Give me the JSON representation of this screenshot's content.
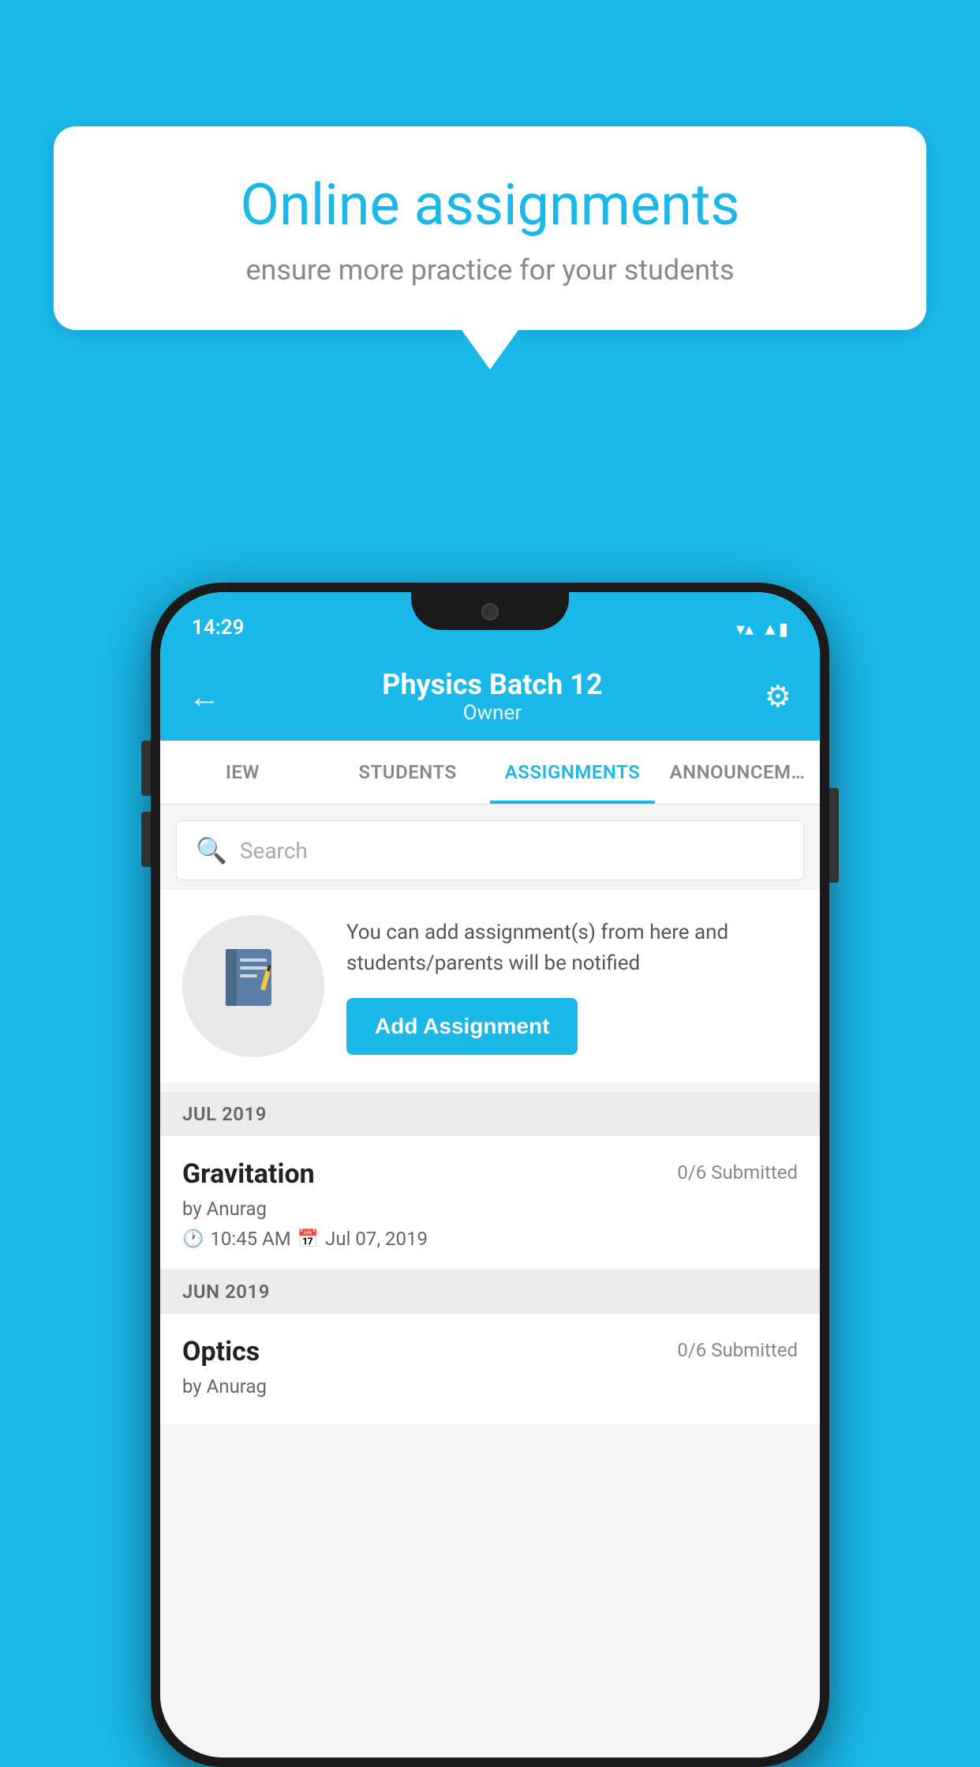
{
  "background_color": "#1ab8e8",
  "speech_bubble": {
    "title": "Online assignments",
    "subtitle": "ensure more practice for your students"
  },
  "status_bar": {
    "time": "14:29",
    "wifi_icon": "▼",
    "signal_icon": "▲",
    "battery_icon": "▮"
  },
  "app_bar": {
    "back_arrow": "←",
    "title": "Physics Batch 12",
    "subtitle": "Owner",
    "settings_icon": "⚙"
  },
  "tabs": [
    {
      "label": "IEW",
      "active": false
    },
    {
      "label": "STUDENTS",
      "active": false
    },
    {
      "label": "ASSIGNMENTS",
      "active": true
    },
    {
      "label": "ANNOUNCEM…",
      "active": false
    }
  ],
  "search": {
    "placeholder": "Search"
  },
  "promo": {
    "description": "You can add assignment(s) from here and students/parents will be notified",
    "button_label": "Add Assignment"
  },
  "assignment_sections": [
    {
      "month_label": "JUL 2019",
      "assignments": [
        {
          "name": "Gravitation",
          "submitted": "0/6 Submitted",
          "author": "by Anurag",
          "time": "10:45 AM",
          "date": "Jul 07, 2019"
        }
      ]
    },
    {
      "month_label": "JUN 2019",
      "assignments": [
        {
          "name": "Optics",
          "submitted": "0/6 Submitted",
          "author": "by Anurag",
          "time": "",
          "date": ""
        }
      ]
    }
  ]
}
